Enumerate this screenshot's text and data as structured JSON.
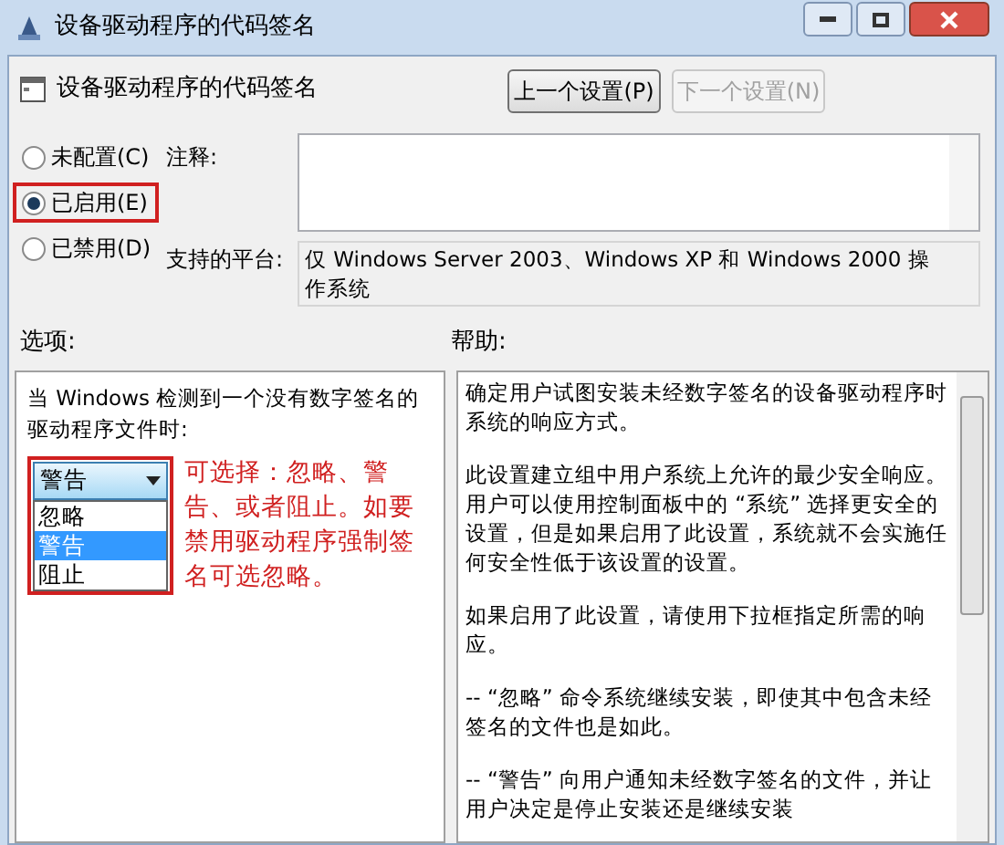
{
  "window": {
    "title": "设备驱动程序的代码签名"
  },
  "header": {
    "title": "设备驱动程序的代码签名",
    "buttons": [
      {
        "label": "上一个设置(P)",
        "disabled": false
      },
      {
        "label": "下一个设置(N)",
        "disabled": true
      }
    ]
  },
  "radios": [
    {
      "label": "未配置(C)",
      "selected": false,
      "highlighted": false
    },
    {
      "label": "已启用(E)",
      "selected": true,
      "highlighted": true
    },
    {
      "label": "已禁用(D)",
      "selected": false,
      "highlighted": false
    }
  ],
  "comment": {
    "label": "注释:"
  },
  "platform": {
    "label": "支持的平台:",
    "value": "仅 Windows Server 2003、Windows XP 和 Windows 2000 操作系统"
  },
  "options": {
    "label": "选项:",
    "prompt": "当 Windows 检测到一个没有数字签名的驱动程序文件时:",
    "dropdown": {
      "value": "警告",
      "items": [
        {
          "label": "忽略",
          "selected": false
        },
        {
          "label": "警告",
          "selected": true
        },
        {
          "label": "阻止",
          "selected": false
        }
      ]
    },
    "annotation": "可选择：忽略、警告、或者阻止。如要禁用驱动程序强制签名可选忽略。"
  },
  "help": {
    "label": "帮助:",
    "paragraphs": [
      "确定用户试图安装未经数字签名的设备驱动程序时系统的响应方式。",
      "此设置建立组中用户系统上允许的最少安全响应。用户可以使用控制面板中的 “系统” 选择更安全的设置，但是如果启用了此设置，系统就不会实施任何安全性低于该设置的设置。",
      "如果启用了此设置，请使用下拉框指定所需的响应。",
      "-- “忽略” 命令系统继续安装，即使其中包含未经签名的文件也是如此。",
      "-- “警告” 向用户通知未经数字签名的文件，并让用户决定是停止安装还是继续安装"
    ]
  }
}
